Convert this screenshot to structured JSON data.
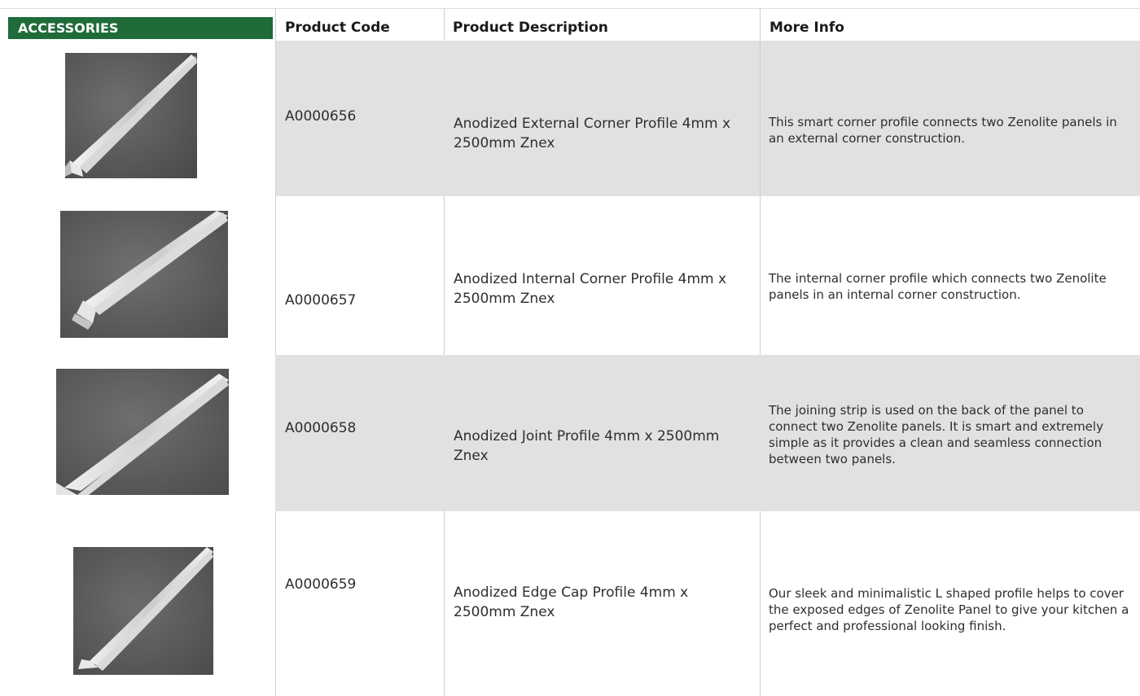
{
  "header": {
    "category": "ACCESSORIES",
    "code": "Product Code",
    "description": "Product Description",
    "more_info": "More Info"
  },
  "products": [
    {
      "code": "A0000656",
      "description": "Anodized External Corner Profile 4mm x 2500mm Znex",
      "info": "This smart corner profile connects two Zenolite panels in an external corner construction.",
      "photo_icon": "external-corner-profile-photo"
    },
    {
      "code": "A0000657",
      "description": "Anodized Internal Corner Profile 4mm x 2500mm Znex",
      "info": "The internal corner profile which connects two Zenolite panels in an internal corner construction.",
      "photo_icon": "internal-corner-profile-photo"
    },
    {
      "code": "A0000658",
      "description": "Anodized Joint Profile 4mm x 2500mm Znex",
      "info": "The joining strip is used on the back of the panel to connect two Zenolite panels. It is smart and extremely simple as it provides a clean and seamless connection between two panels.",
      "photo_icon": "joint-profile-photo"
    },
    {
      "code": "A0000659",
      "description": "Anodized Edge Cap Profile 4mm x 2500mm Znex",
      "info": "Our sleek and minimalistic L shaped profile helps to cover the exposed edges of Zenolite Panel to give your kitchen a perfect and professional looking finish.",
      "photo_icon": "edge-cap-profile-photo"
    }
  ],
  "colors": {
    "header_green": "#1f6b3a",
    "row_shade": "#e1e1e1"
  }
}
